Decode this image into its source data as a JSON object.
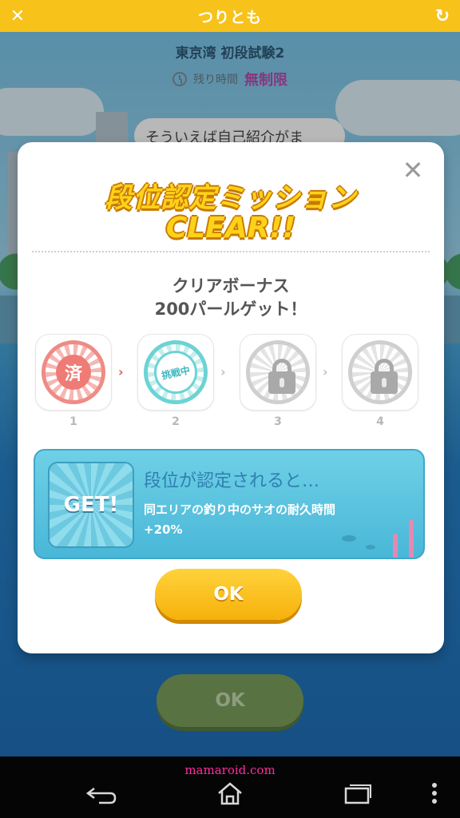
{
  "header": {
    "title": "つりとも"
  },
  "stage": {
    "title": "東京湾 初段試験2",
    "time_label": "残り時間",
    "time_value": "無制限",
    "bubble_text": "そういえば自己紹介がま"
  },
  "modal": {
    "banner_line1": "段位認定ミッション",
    "banner_line2": "CLEAR!!",
    "bonus_line1": "クリアボーナス",
    "bonus_line2": "200パールゲット！",
    "stamps": [
      {
        "number": "1",
        "state": "done",
        "stamp_text": "済"
      },
      {
        "number": "2",
        "state": "active",
        "stamp_text": "挑戦中"
      },
      {
        "number": "3",
        "state": "locked",
        "stamp_text": ""
      },
      {
        "number": "4",
        "state": "locked",
        "stamp_text": ""
      }
    ],
    "info": {
      "badge": "GET!",
      "title": "段位が認定されると…",
      "desc_line1": "同エリアの釣り中のサオの耐久時間",
      "desc_line2": "+20%"
    },
    "ok_label": "OK"
  },
  "background_ok_label": "OK",
  "watermark": "mamaroid.com",
  "colors": {
    "topbar": "#f7c21a",
    "accent_purple": "#b94db1",
    "ok_yellow": "#f6b10b",
    "panel_blue": "#49b7d8"
  }
}
